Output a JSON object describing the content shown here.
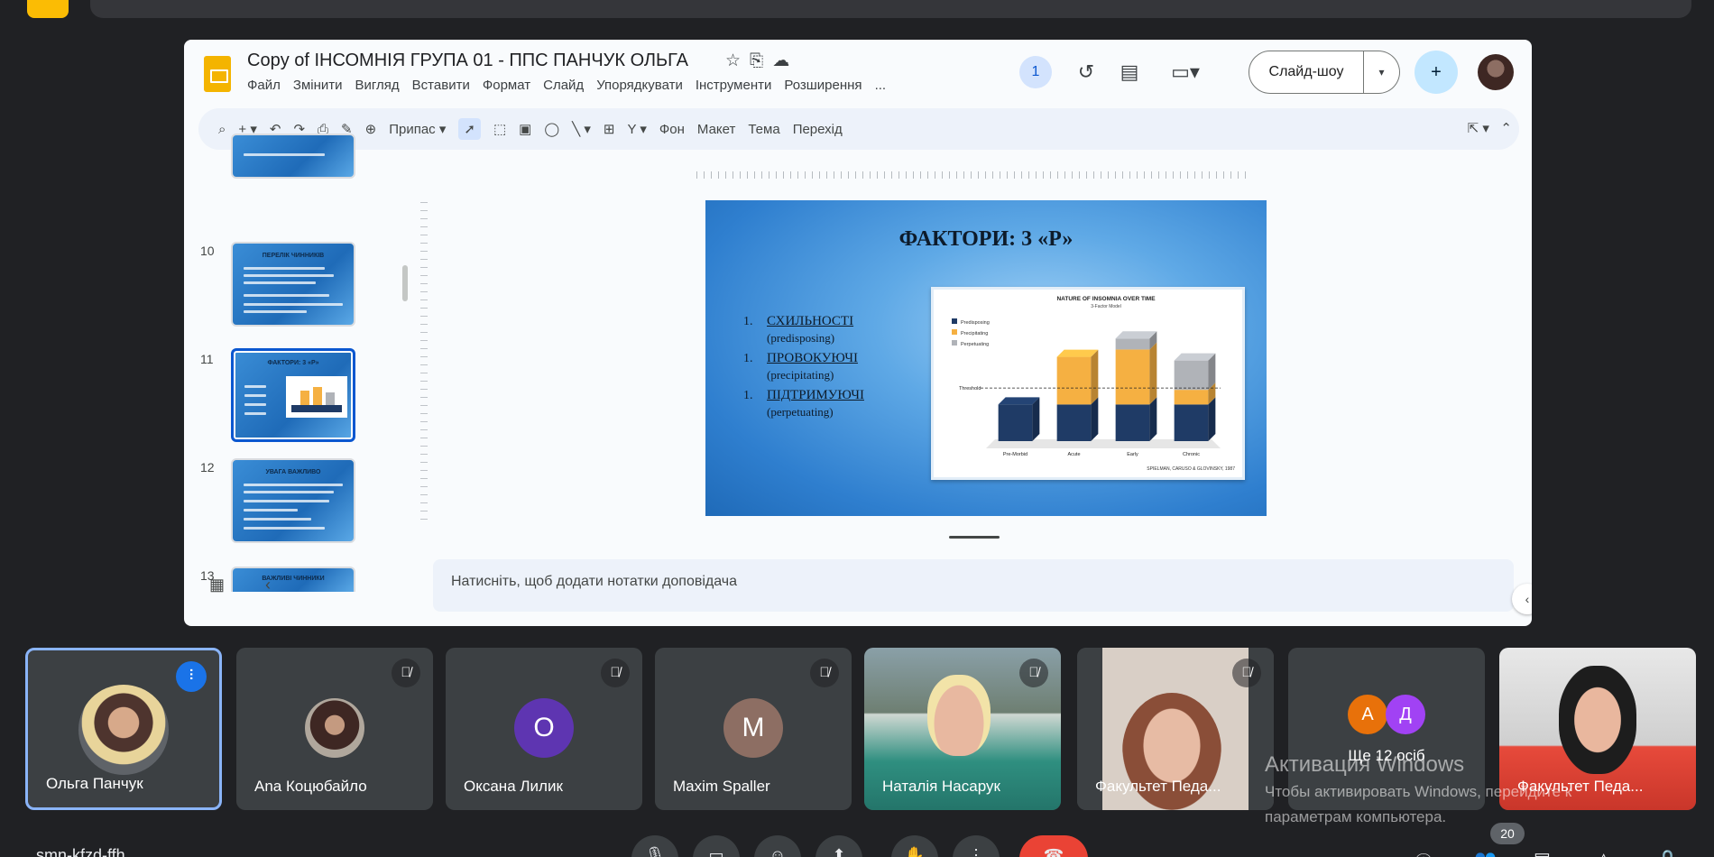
{
  "doc": {
    "title": "Copy of ІНСОМНІЯ  ГРУПА 01 - ППС ПАНЧУК ОЛЬГА",
    "menu": [
      "Файл",
      "Змінити",
      "Вигляд",
      "Вставити",
      "Формат",
      "Слайд",
      "Упорядкувати",
      "Інструменти",
      "Розширення",
      "..."
    ],
    "active_users": "1",
    "slideshow_label": "Слайд-шоу",
    "toolbar": {
      "zoom": "Припас",
      "background": "Фон",
      "layout": "Макет",
      "theme": "Тема",
      "transition": "Перехід"
    },
    "notes_placeholder": "Натисніть, щоб додати нотатки доповідача"
  },
  "filmstrip": {
    "slides": [
      {
        "num": "10",
        "title": "ПЕРЕЛІК ЧИННИКІВ"
      },
      {
        "num": "11",
        "title": "ФАКТОРИ: 3 «Р»"
      },
      {
        "num": "12",
        "title": "УВАГА ВАЖЛИВО"
      },
      {
        "num": "13",
        "title": "ВАЖЛИВІ ЧИННИКИ"
      }
    ]
  },
  "slide": {
    "title": "ФАКТОРИ: 3 «Р»",
    "items": [
      {
        "num": "1.",
        "name": "СХИЛЬНОСТІ",
        "sub": "(predisposing)"
      },
      {
        "num": "1.",
        "name": "ПРОВОКУЮЧІ",
        "sub": "(precipitating)"
      },
      {
        "num": "1.",
        "name": "ПІДТРИМУЮЧІ",
        "sub": "(perpetuating)"
      }
    ]
  },
  "chart_data": {
    "type": "bar",
    "title": "NATURE OF INSOMNIA OVER TIME",
    "subtitle": "3-Factor Model",
    "categories": [
      "Pre-Morbid",
      "Acute",
      "Early",
      "Chronic"
    ],
    "series": [
      {
        "name": "Predisposing",
        "color": "#1f3b66",
        "values": [
          1,
          1,
          1,
          1
        ]
      },
      {
        "name": "Precipitating",
        "color": "#f5b042",
        "values": [
          0,
          1.3,
          1.5,
          0.4
        ]
      },
      {
        "name": "Perpetuating",
        "color": "#b0b3b8",
        "values": [
          0,
          0,
          0.3,
          0.8
        ]
      }
    ],
    "threshold": 1.45,
    "threshold_label": "Threshold",
    "source": "SPIELMAN, CARUSO & GLOVINSKY, 1987",
    "ylim": [
      0,
      3.2
    ]
  },
  "participants": [
    {
      "name": "Ольга Панчук",
      "type": "photo",
      "speaking": true
    },
    {
      "name": "Ana Коцюбайло",
      "type": "photo2",
      "muted": true
    },
    {
      "name": "Оксана Лилик",
      "type": "initial",
      "initial": "О",
      "color": "#5e35b1",
      "muted": true
    },
    {
      "name": "Maxim Spaller",
      "type": "initial",
      "initial": "M",
      "color": "#8d6e63",
      "muted": true
    },
    {
      "name": "Наталія Насарук",
      "type": "video1",
      "muted": true
    },
    {
      "name": "Факультет Педа...",
      "type": "video2",
      "muted": true
    },
    {
      "name": "Ще 12 осіб",
      "type": "group",
      "initials": [
        "А",
        "Д"
      ]
    },
    {
      "name": "Факультет Педа...",
      "type": "video3"
    }
  ],
  "watermark": {
    "title": "Активация Windows",
    "line1": "Чтобы активировать Windows, перейдите к",
    "line2": "параметрам компьютера."
  },
  "bottom": {
    "meeting_code": "smn-kfzd-ffh",
    "people_count": "20"
  }
}
